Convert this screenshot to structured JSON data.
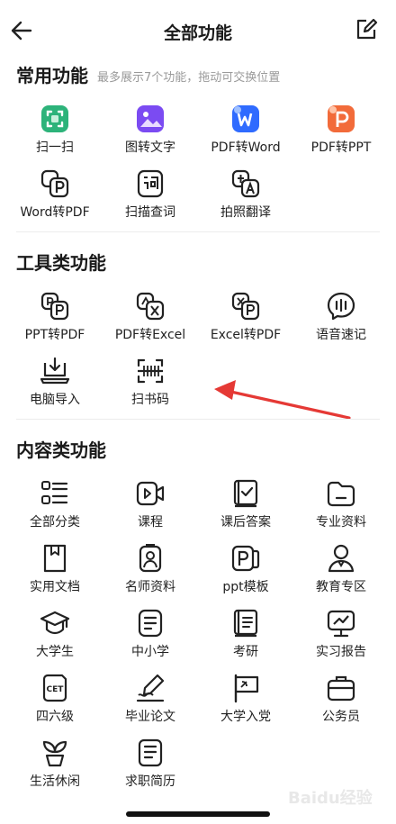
{
  "header": {
    "title": "全部功能"
  },
  "common": {
    "title": "常用功能",
    "hint": "最多展示7个功能，拖动可交换位置",
    "items": [
      {
        "label": "扫一扫",
        "icon": "scan-icon"
      },
      {
        "label": "图转文字",
        "icon": "image-to-text-icon"
      },
      {
        "label": "PDF转Word",
        "icon": "pdf-to-word-icon"
      },
      {
        "label": "PDF转PPT",
        "icon": "pdf-to-ppt-icon"
      },
      {
        "label": "Word转PDF",
        "icon": "word-to-pdf-icon"
      },
      {
        "label": "扫描查词",
        "icon": "scan-word-icon"
      },
      {
        "label": "拍照翻译",
        "icon": "photo-translate-icon"
      }
    ]
  },
  "tools": {
    "title": "工具类功能",
    "items": [
      {
        "label": "PPT转PDF",
        "icon": "ppt-to-pdf-icon"
      },
      {
        "label": "PDF转Excel",
        "icon": "pdf-to-excel-icon"
      },
      {
        "label": "Excel转PDF",
        "icon": "excel-to-pdf-icon"
      },
      {
        "label": "语音速记",
        "icon": "voice-note-icon"
      },
      {
        "label": "电脑导入",
        "icon": "computer-import-icon"
      },
      {
        "label": "扫书码",
        "icon": "scan-book-code-icon"
      }
    ]
  },
  "content": {
    "title": "内容类功能",
    "items": [
      {
        "label": "全部分类",
        "icon": "all-categories-icon"
      },
      {
        "label": "课程",
        "icon": "course-icon"
      },
      {
        "label": "课后答案",
        "icon": "homework-answers-icon"
      },
      {
        "label": "专业资料",
        "icon": "professional-docs-icon"
      },
      {
        "label": "实用文档",
        "icon": "practical-docs-icon"
      },
      {
        "label": "名师资料",
        "icon": "teacher-materials-icon"
      },
      {
        "label": "ppt模板",
        "icon": "ppt-template-icon"
      },
      {
        "label": "教育专区",
        "icon": "education-zone-icon"
      },
      {
        "label": "大学生",
        "icon": "graduation-cap-icon"
      },
      {
        "label": "中小学",
        "icon": "school-icon"
      },
      {
        "label": "考研",
        "icon": "postgrad-exam-icon"
      },
      {
        "label": "实习报告",
        "icon": "internship-report-icon"
      },
      {
        "label": "四六级",
        "icon": "cet-icon"
      },
      {
        "label": "毕业论文",
        "icon": "thesis-icon"
      },
      {
        "label": "大学入党",
        "icon": "party-flag-icon"
      },
      {
        "label": "公务员",
        "icon": "civil-servant-icon"
      },
      {
        "label": "生活休闲",
        "icon": "leisure-plant-icon"
      },
      {
        "label": "求职简历",
        "icon": "resume-icon"
      }
    ]
  },
  "cet_text": "CET",
  "watermark": "Baidu经验",
  "colors": {
    "accent_red": "#e53935",
    "scan_green": "#2db37a",
    "image_purple": "#7b4bf2",
    "word_blue": "#2f6bff",
    "ppt_orange": "#f26b3a"
  }
}
